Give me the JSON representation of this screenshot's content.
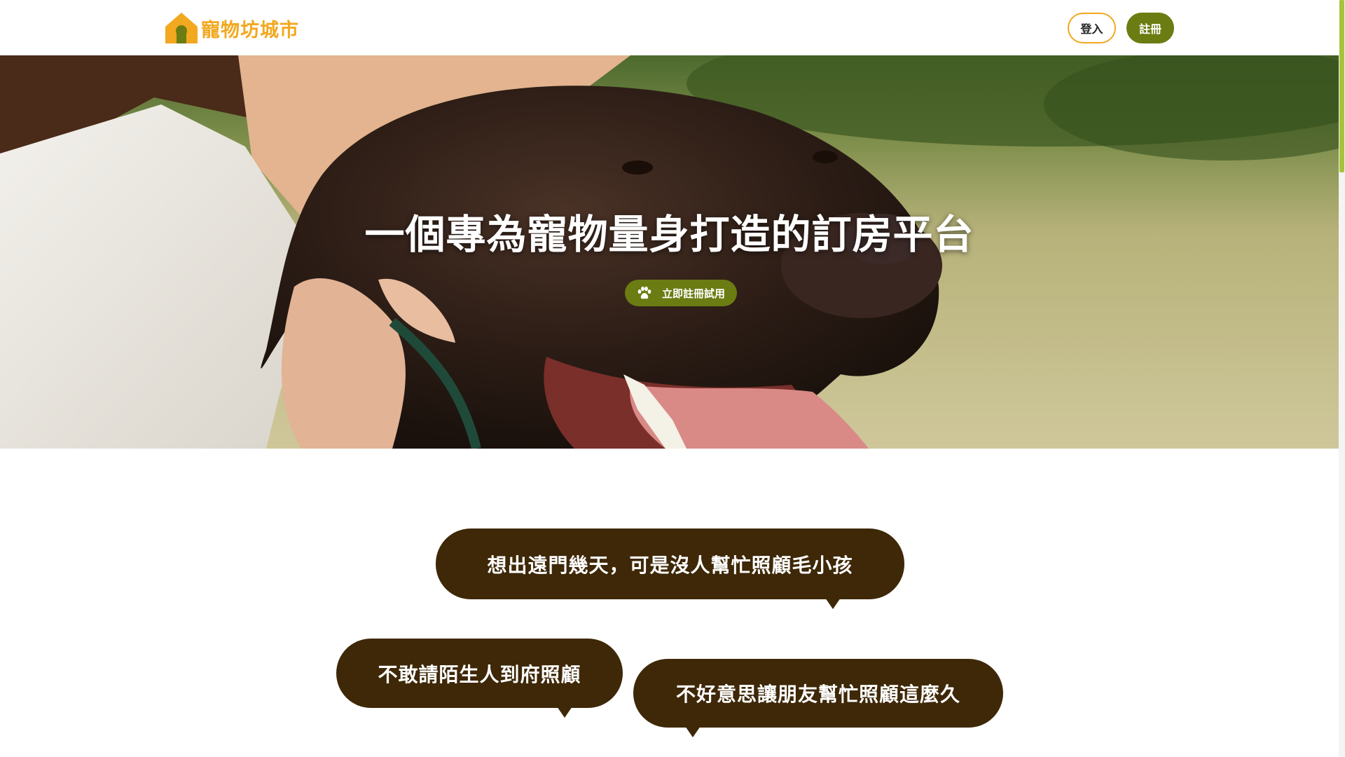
{
  "header": {
    "logo_text": "寵物坊城市",
    "logo_icon": "house-icon",
    "login_label": "登入",
    "register_label": "註冊"
  },
  "hero": {
    "title": "一個專為寵物量身打造的訂房平台",
    "cta_label": "立即註冊試用",
    "cta_icon": "paw-icon",
    "photo": "person-hugging-dog-photo"
  },
  "bubbles": [
    "想出遠門幾天，可是沒人幫忙照顧毛小孩",
    "不敢請陌生人到府照顧",
    "不好意思讓朋友幫忙照顧這麼久"
  ],
  "colors": {
    "brand_orange": "#f2a81f",
    "brand_olive": "#6b7c12",
    "bubble_brown": "#3e2808",
    "scrollbar_thumb": "#a6c43b"
  }
}
